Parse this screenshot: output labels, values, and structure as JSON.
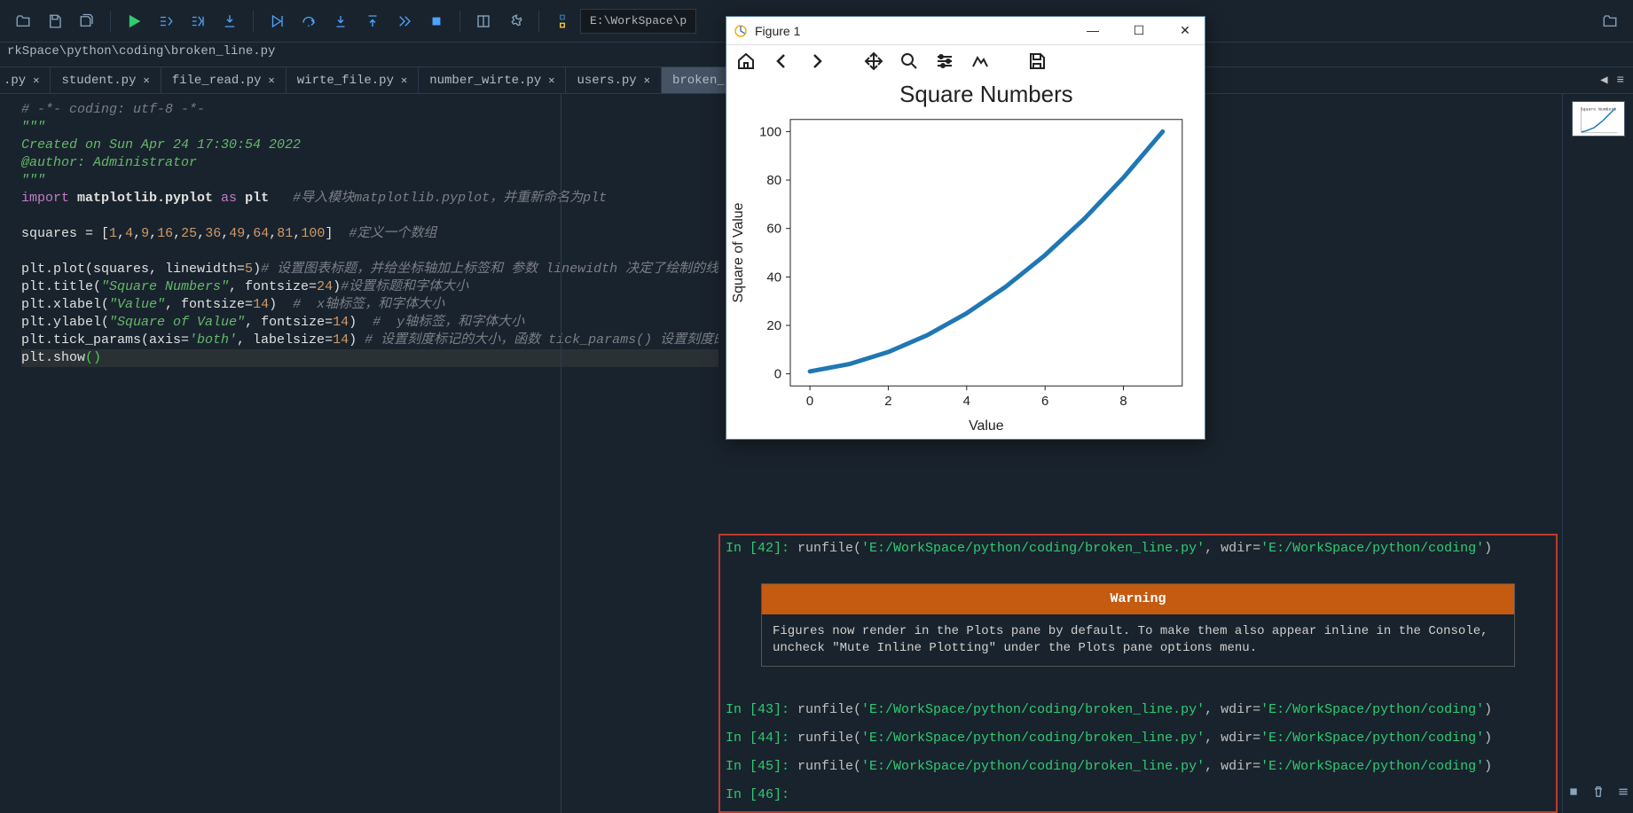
{
  "toolbar": {
    "address": "E:\\WorkSpace\\p"
  },
  "path": "rkSpace\\python\\coding\\broken_line.py",
  "tabs": {
    "partial": ".py",
    "items": [
      "student.py",
      "file_read.py",
      "wirte_file.py",
      "number_wirte.py",
      "users.py",
      "broken_line.py"
    ],
    "activeIndex": 5
  },
  "code": {
    "lines": [
      {
        "segs": [
          {
            "t": "# -*- coding: utf-8 -*-",
            "c": "cmt"
          }
        ]
      },
      {
        "segs": [
          {
            "t": "\"\"\"",
            "c": "docstr"
          }
        ]
      },
      {
        "segs": [
          {
            "t": "Created on Sun Apr 24 17:30:54 2022",
            "c": "docstr"
          }
        ]
      },
      {
        "segs": [
          {
            "t": "@author: Administrator",
            "c": "docstr"
          }
        ]
      },
      {
        "segs": [
          {
            "t": "\"\"\"",
            "c": "docstr"
          }
        ]
      },
      {
        "segs": [
          {
            "t": "import ",
            "c": "kw"
          },
          {
            "t": "matplotlib.pyplot",
            "c": "mod",
            "b": true
          },
          {
            "t": " as ",
            "c": "as"
          },
          {
            "t": "plt",
            "c": "mod",
            "b": true
          },
          {
            "t": "   #导入模块matplotlib.pyplot，并重新命名为plt",
            "c": "cmt"
          }
        ]
      },
      {
        "segs": [
          {
            "t": "",
            "c": "fn"
          }
        ]
      },
      {
        "segs": [
          {
            "t": "squares = [",
            "c": "fn"
          },
          {
            "t": "1",
            "c": "num"
          },
          {
            "t": ",",
            "c": "fn"
          },
          {
            "t": "4",
            "c": "num"
          },
          {
            "t": ",",
            "c": "fn"
          },
          {
            "t": "9",
            "c": "num"
          },
          {
            "t": ",",
            "c": "fn"
          },
          {
            "t": "16",
            "c": "num"
          },
          {
            "t": ",",
            "c": "fn"
          },
          {
            "t": "25",
            "c": "num"
          },
          {
            "t": ",",
            "c": "fn"
          },
          {
            "t": "36",
            "c": "num"
          },
          {
            "t": ",",
            "c": "fn"
          },
          {
            "t": "49",
            "c": "num"
          },
          {
            "t": ",",
            "c": "fn"
          },
          {
            "t": "64",
            "c": "num"
          },
          {
            "t": ",",
            "c": "fn"
          },
          {
            "t": "81",
            "c": "num"
          },
          {
            "t": ",",
            "c": "fn"
          },
          {
            "t": "100",
            "c": "num"
          },
          {
            "t": "]  ",
            "c": "fn"
          },
          {
            "t": "#定义一个数组",
            "c": "cmt"
          }
        ]
      },
      {
        "segs": [
          {
            "t": "",
            "c": "fn"
          }
        ]
      },
      {
        "segs": [
          {
            "t": "plt.plot(squares, linewidth=",
            "c": "fn"
          },
          {
            "t": "5",
            "c": "num"
          },
          {
            "t": ")",
            "c": "fn"
          },
          {
            "t": "# 设置图表标题，并给坐标轴加上标签和 参数 linewidth 决定了绘制的线条的粗细",
            "c": "cmt"
          }
        ]
      },
      {
        "segs": [
          {
            "t": "plt.title(",
            "c": "fn"
          },
          {
            "t": "\"Square Numbers\"",
            "c": "str"
          },
          {
            "t": ", fontsize=",
            "c": "fn"
          },
          {
            "t": "24",
            "c": "num"
          },
          {
            "t": ")",
            "c": "fn"
          },
          {
            "t": "#设置标题和字体大小",
            "c": "cmt"
          }
        ]
      },
      {
        "segs": [
          {
            "t": "plt.xlabel(",
            "c": "fn"
          },
          {
            "t": "\"Value\"",
            "c": "str"
          },
          {
            "t": ", fontsize=",
            "c": "fn"
          },
          {
            "t": "14",
            "c": "num"
          },
          {
            "t": ")  ",
            "c": "fn"
          },
          {
            "t": "#  x轴标签，和字体大小",
            "c": "cmt"
          }
        ]
      },
      {
        "segs": [
          {
            "t": "plt.ylabel(",
            "c": "fn"
          },
          {
            "t": "\"Square of Value\"",
            "c": "str"
          },
          {
            "t": ", fontsize=",
            "c": "fn"
          },
          {
            "t": "14",
            "c": "num"
          },
          {
            "t": ")  ",
            "c": "fn"
          },
          {
            "t": "#  y轴标签，和字体大小",
            "c": "cmt"
          }
        ]
      },
      {
        "segs": [
          {
            "t": "plt.tick_params(axis=",
            "c": "fn"
          },
          {
            "t": "'both'",
            "c": "str"
          },
          {
            "t": ", labelsize=",
            "c": "fn"
          },
          {
            "t": "14",
            "c": "num"
          },
          {
            "t": ") ",
            "c": "fn"
          },
          {
            "t": "# 设置刻度标记的大小，函数 tick_params() 设置刻度的样式",
            "c": "cmt"
          }
        ]
      },
      {
        "hl": true,
        "segs": [
          {
            "t": "plt.show",
            "c": "fn"
          },
          {
            "t": "()",
            "c": "par"
          }
        ]
      }
    ]
  },
  "figure": {
    "title": "Figure 1"
  },
  "chart_data": {
    "type": "line",
    "title": "Square Numbers",
    "xlabel": "Value",
    "ylabel": "Square of Value",
    "x": [
      0,
      1,
      2,
      3,
      4,
      5,
      6,
      7,
      8,
      9
    ],
    "values": [
      1,
      4,
      9,
      16,
      25,
      36,
      49,
      64,
      81,
      100
    ],
    "xticks": [
      0,
      2,
      4,
      6,
      8
    ],
    "yticks": [
      0,
      20,
      40,
      60,
      80,
      100
    ],
    "xlim": [
      -0.5,
      9.5
    ],
    "ylim": [
      -5,
      105
    ]
  },
  "console": {
    "warning_title": "Warning",
    "warning_body": "Figures now render in the Plots pane by default. To make them also appear inline in the Console, uncheck \"Mute Inline Plotting\" under the Plots pane options menu.",
    "entries": [
      {
        "n": "42",
        "call": "runfile(",
        "arg1": "'E:/WorkSpace/python/coding/broken_line.py'",
        "mid": ", wdir=",
        "arg2": "'E:/WorkSpace/python/coding'",
        "end": ")",
        "warn": true
      },
      {
        "n": "43",
        "call": "runfile(",
        "arg1": "'E:/WorkSpace/python/coding/broken_line.py'",
        "mid": ", wdir=",
        "arg2": "'E:/WorkSpace/python/coding'",
        "end": ")"
      },
      {
        "n": "44",
        "call": "runfile(",
        "arg1": "'E:/WorkSpace/python/coding/broken_line.py'",
        "mid": ", wdir=",
        "arg2": "'E:/WorkSpace/python/coding'",
        "end": ")"
      },
      {
        "n": "45",
        "call": "runfile(",
        "arg1": "'E:/WorkSpace/python/coding/broken_line.py'",
        "mid": ", wdir=",
        "arg2": "'E:/WorkSpace/python/coding'",
        "end": ")"
      },
      {
        "n": "46"
      }
    ]
  }
}
